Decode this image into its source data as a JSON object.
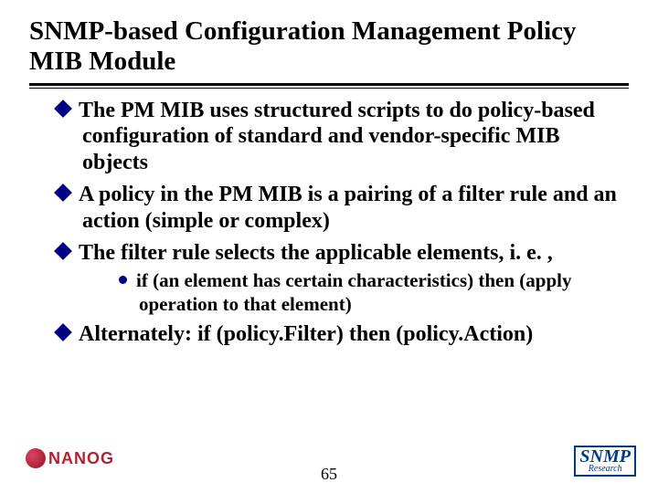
{
  "title": "SNMP-based Configuration Management Policy MIB Module",
  "bullets": [
    {
      "text": "The PM MIB uses structured scripts to do policy-based configuration of standard and vendor-specific MIB objects"
    },
    {
      "text": "A policy in the PM MIB is a pairing of a filter rule and an action (simple or complex)"
    },
    {
      "text": "The filter rule selects the applicable elements, i. e. ,",
      "sub": [
        {
          "text": "if (an element has certain characteristics) then (apply operation to that element)"
        }
      ]
    },
    {
      "text": "Alternately: if (policy.Filter) then (policy.Action)"
    }
  ],
  "page_number": "65",
  "logos": {
    "nanog_text": "NANOG",
    "snmp_text": "SNMP",
    "snmp_sub": "Research"
  }
}
